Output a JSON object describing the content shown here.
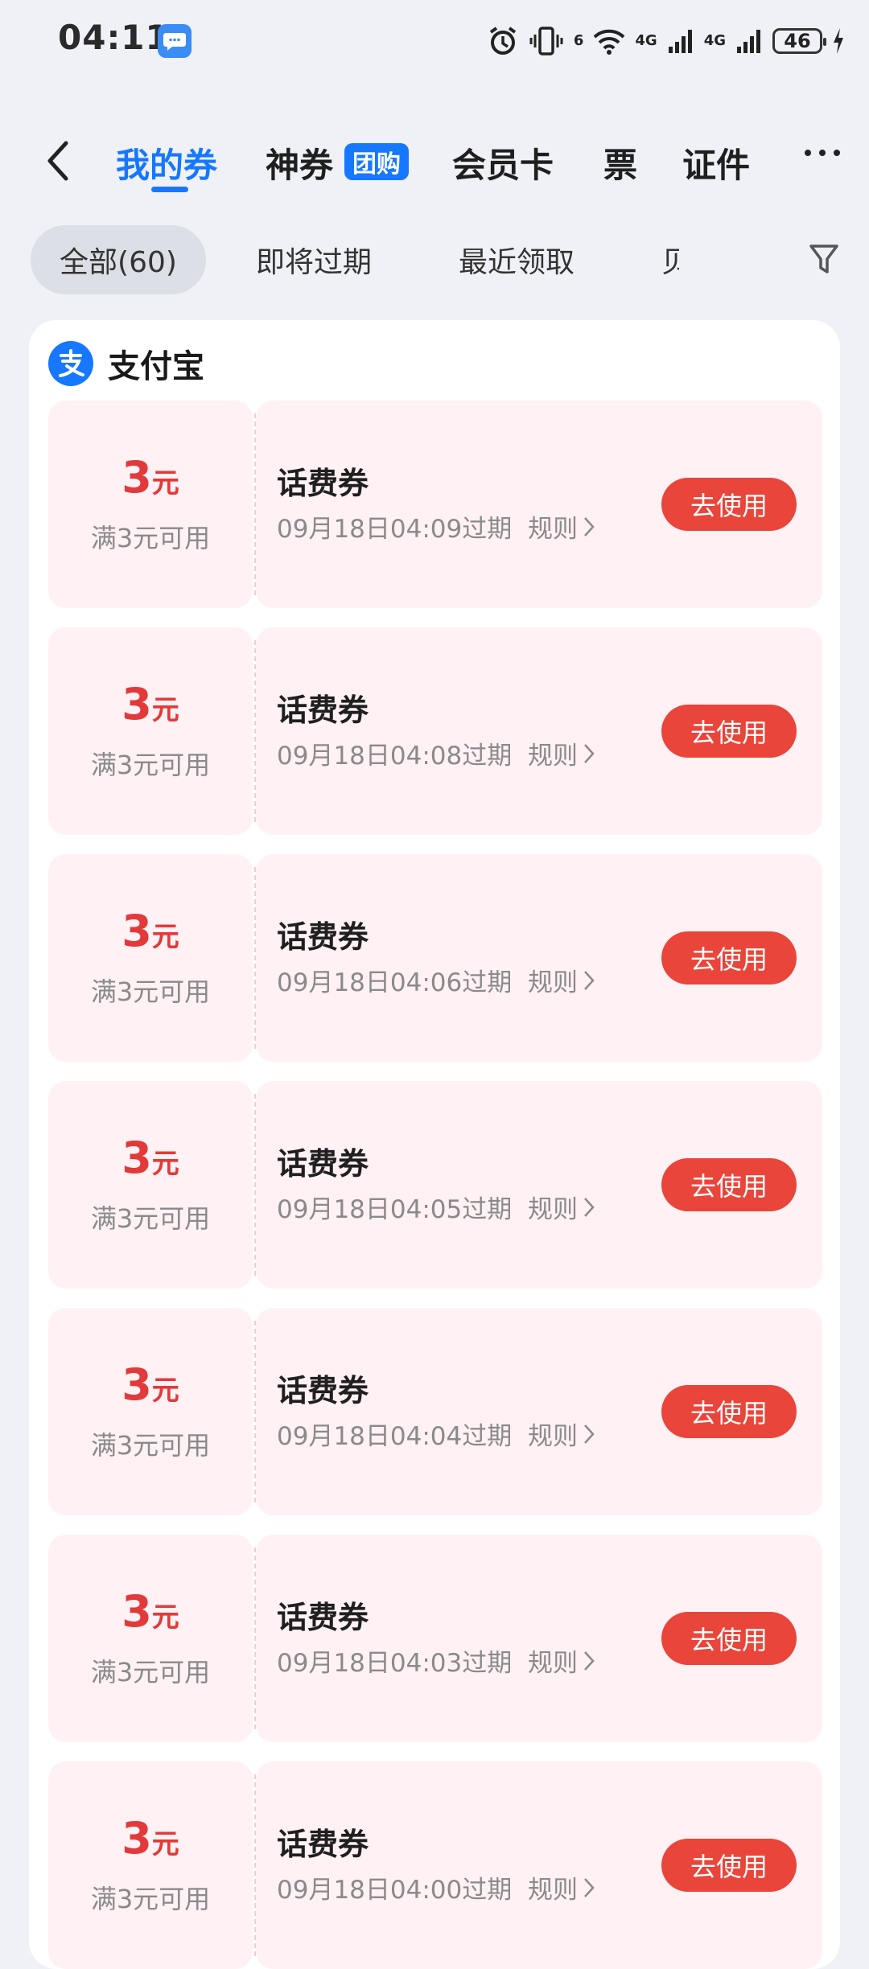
{
  "status_bar": {
    "time": "04:11",
    "network_1": "4G",
    "network_2": "4G",
    "wifi_label": "6",
    "battery": "46"
  },
  "nav": {
    "tabs": [
      {
        "label": "我的券",
        "active": true
      },
      {
        "label": "神券",
        "active": false
      },
      {
        "label": "会员卡",
        "active": false
      },
      {
        "label": "票",
        "active": false
      },
      {
        "label": "证件",
        "active": false
      }
    ],
    "badge": "团购"
  },
  "filters": [
    {
      "label": "全部(60)",
      "active": true
    },
    {
      "label": "即将过期",
      "active": false
    },
    {
      "label": "最近领取",
      "active": false
    },
    {
      "label": "贝",
      "active": false
    }
  ],
  "merchant": {
    "name": "支付宝"
  },
  "coupons": [
    {
      "amount": "3",
      "unit": "元",
      "condition": "满3元可用",
      "title": "话费券",
      "expire": "09月18日04:09过期",
      "rule": "规则",
      "button": "去使用"
    },
    {
      "amount": "3",
      "unit": "元",
      "condition": "满3元可用",
      "title": "话费券",
      "expire": "09月18日04:08过期",
      "rule": "规则",
      "button": "去使用"
    },
    {
      "amount": "3",
      "unit": "元",
      "condition": "满3元可用",
      "title": "话费券",
      "expire": "09月18日04:06过期",
      "rule": "规则",
      "button": "去使用"
    },
    {
      "amount": "3",
      "unit": "元",
      "condition": "满3元可用",
      "title": "话费券",
      "expire": "09月18日04:05过期",
      "rule": "规则",
      "button": "去使用"
    },
    {
      "amount": "3",
      "unit": "元",
      "condition": "满3元可用",
      "title": "话费券",
      "expire": "09月18日04:04过期",
      "rule": "规则",
      "button": "去使用"
    },
    {
      "amount": "3",
      "unit": "元",
      "condition": "满3元可用",
      "title": "话费券",
      "expire": "09月18日04:03过期",
      "rule": "规则",
      "button": "去使用"
    },
    {
      "amount": "3",
      "unit": "元",
      "condition": "满3元可用",
      "title": "话费券",
      "expire": "09月18日04:00过期",
      "rule": "规则",
      "button": "去使用"
    }
  ],
  "colors": {
    "accent": "#1677ff",
    "coupon_red": "#e23a3a",
    "button_red": "#e9453a",
    "coupon_bg": "#fff1f4"
  }
}
